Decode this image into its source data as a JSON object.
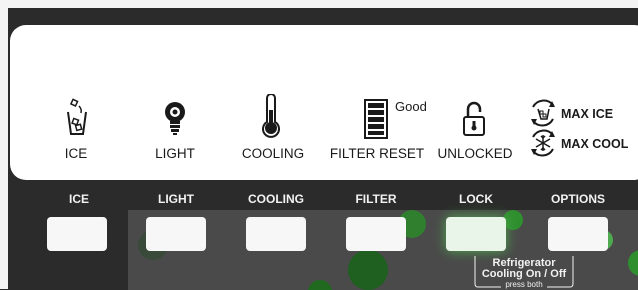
{
  "display": {
    "icons": [
      {
        "name": "ice-icon",
        "label": "ICE"
      },
      {
        "name": "light-bulb-icon",
        "label": "LIGHT"
      },
      {
        "name": "thermometer-icon",
        "label": "COOLING"
      },
      {
        "name": "filter-icon",
        "label": "FILTER RESET"
      },
      {
        "name": "padlock-icon",
        "label": "UNLOCKED"
      }
    ],
    "filter_status": "Good",
    "options": [
      {
        "name": "max-ice-icon",
        "label": "MAX ICE"
      },
      {
        "name": "max-cool-icon",
        "label": "MAX COOL"
      }
    ]
  },
  "buttons": [
    {
      "label": "ICE"
    },
    {
      "label": "LIGHT"
    },
    {
      "label": "COOLING"
    },
    {
      "label": "FILTER"
    },
    {
      "label": "LOCK"
    },
    {
      "label": "OPTIONS"
    }
  ],
  "note": {
    "line1": "Refrigerator",
    "line2": "Cooling On / Off",
    "line3": "press both"
  },
  "colors": {
    "panel": "#2b2b2b",
    "display": "#ffffff",
    "button": "#f7f7f7",
    "highlight": "#1f7a1f"
  }
}
